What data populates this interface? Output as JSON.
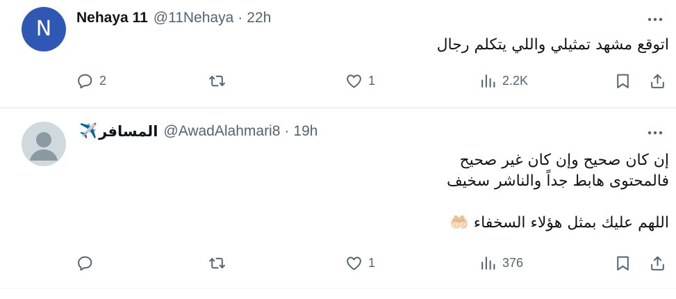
{
  "tweets": [
    {
      "avatar_letter": "N",
      "avatar_color": "#2f58b4",
      "name": "Nehaya 11",
      "handle": "@11Nehaya",
      "separator": "·",
      "time": "22h",
      "body_lines": [
        "اتوقع مشهد تمثيلي واللي يتكلم رجال"
      ],
      "replies": "2",
      "reposts": "",
      "likes": "1",
      "views": "2.2K"
    },
    {
      "name": "المسافر",
      "name_emoji": "✈️",
      "handle": "@AwadAlahmari8",
      "separator": "·",
      "time": "19h",
      "body_lines": [
        "إن كان صحيح وإن كان غير صحيح",
        "فالمحتوى هابط جداً والناشر سخيف",
        "",
        "اللهم عليك بمثل هؤلاء السخفاء 🤲🏻"
      ],
      "replies": "",
      "reposts": "",
      "likes": "1",
      "views": "376"
    }
  ],
  "colors": {
    "text": "#0f1419",
    "muted": "#536471",
    "divider": "#eff3f4",
    "default_avatar_bg": "#cfd9de"
  },
  "icons": [
    "reply-icon",
    "repost-icon",
    "like-icon",
    "views-icon",
    "bookmark-icon",
    "share-icon",
    "more-icon",
    "default-avatar-icon"
  ]
}
